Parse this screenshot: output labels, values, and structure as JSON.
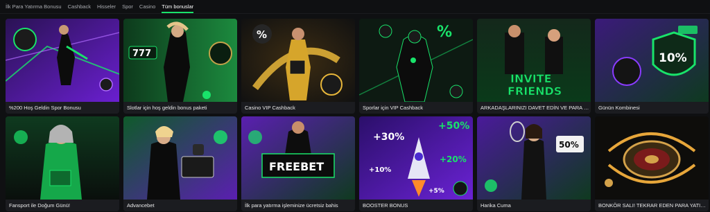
{
  "tabs": [
    {
      "label": "İlk Para Yatırma Bonusu",
      "active": false
    },
    {
      "label": "Cashback",
      "active": false
    },
    {
      "label": "Hisseler",
      "active": false
    },
    {
      "label": "Spor",
      "active": false
    },
    {
      "label": "Casino",
      "active": false
    },
    {
      "label": "Tüm bonuslar",
      "active": true
    }
  ],
  "cards": [
    {
      "title": "%200 Hoş Geldin Spor Bonusu"
    },
    {
      "title": "Slotlar için hoş geldin bonus paketi",
      "art_text": "777"
    },
    {
      "title": "Casino VIP Cashback",
      "art_text": "%"
    },
    {
      "title": "Sporlar için VIP Cashback",
      "art_text": "%"
    },
    {
      "title": "ARKADAŞLARINIZI DAVET EDİN VE PARA KAZANIN",
      "art_text_1": "INVITE",
      "art_text_2": "FRIENDS"
    },
    {
      "title": "Günün Kombinesi",
      "art_text": "10%"
    },
    {
      "title": "Fansport ile Doğum Günü!"
    },
    {
      "title": "Advancebet"
    },
    {
      "title": "İlk para yatırma işleminize ücretsiz bahis",
      "art_text": "FREEBET"
    },
    {
      "title": "BOOSTER BONUS",
      "art_text_1": "+30%",
      "art_text_2": "+50%",
      "art_text_3": "+10%",
      "art_text_4": "+20%",
      "art_text_5": "+5%"
    },
    {
      "title": "Harika Cuma",
      "art_text": "50%"
    },
    {
      "title": "BONKÖR SALI! TEKRAR EDEN PARA YATIRMA BONUSU"
    }
  ],
  "colors": {
    "accent": "#19e36a",
    "purple": "#7b2ff2",
    "background": "#0f1012",
    "caption_bg": "#1b1c20"
  }
}
